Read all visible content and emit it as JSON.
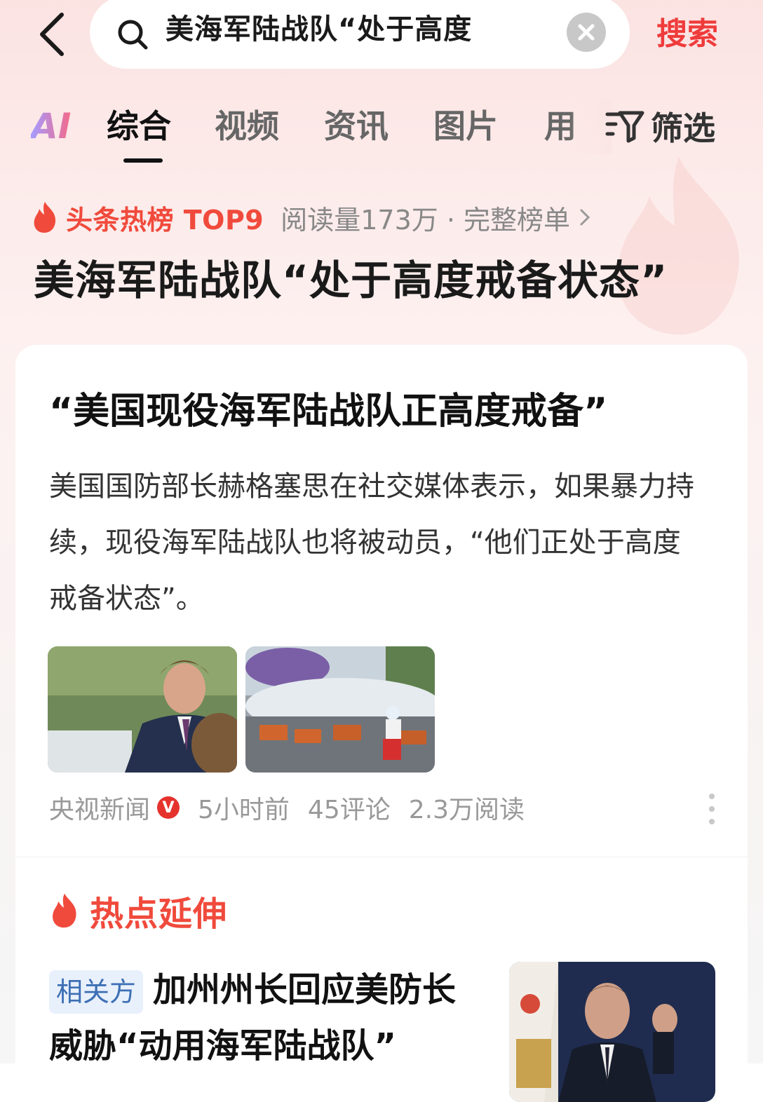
{
  "search": {
    "query": "美海军陆战队“处于高度",
    "button_label": "搜索"
  },
  "tabs": [
    {
      "label": "AI"
    },
    {
      "label": "综合",
      "active": true
    },
    {
      "label": "视频"
    },
    {
      "label": "资讯"
    },
    {
      "label": "图片"
    },
    {
      "label": "用"
    }
  ],
  "filter_label": "筛选",
  "hot_board": {
    "label": "头条热榜 TOP9",
    "meta": "阅读量173万 · 完整榜单",
    "title": "美海军陆战队“处于高度戒备状态”"
  },
  "article": {
    "title": "“美国现役海军陆战队正高度戒备”",
    "summary": "美国国防部长赫格塞思在社交媒体表示，如果暴力持续，现役海军陆战队也将被动员，“他们正处于高度戒备状态”。",
    "source": "央视新闻",
    "verified_badge": "V",
    "time": "5小时前",
    "comments": "45评论",
    "reads": "2.3万阅读"
  },
  "extension": {
    "label": "热点延伸",
    "item": {
      "tag": "相关方",
      "title": "加州州长回应美防长威胁“动用海军陆战队”"
    }
  },
  "colors": {
    "accent_red": "#ef3b3b",
    "hot_orange": "#f04a3c",
    "tag_blue": "#3d6fb5"
  }
}
